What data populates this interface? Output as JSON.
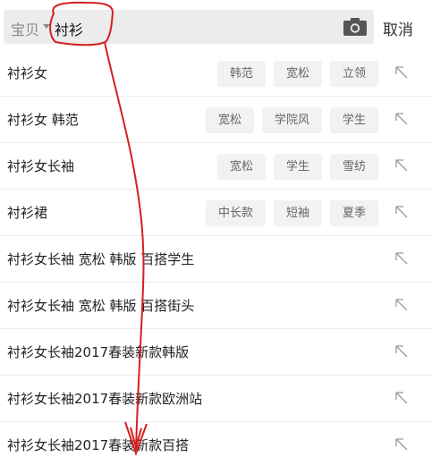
{
  "search": {
    "scope_label": "宝贝",
    "query": "衬衫"
  },
  "cancel_label": "取消",
  "icons": {
    "camera": "camera-icon",
    "fill": "arrow-up-left-icon",
    "caret": "caret-down-icon"
  },
  "colors": {
    "annotation": "#d42020",
    "search_bg": "#ececec",
    "chip_bg": "#f2f2f2"
  },
  "suggestions": [
    {
      "text": "衬衫女",
      "chips": [
        "韩范",
        "宽松",
        "立领"
      ]
    },
    {
      "text": "衬衫女 韩范",
      "chips": [
        "宽松",
        "学院风",
        "学生"
      ]
    },
    {
      "text": "衬衫女长袖",
      "chips": [
        "宽松",
        "学生",
        "雪纺"
      ]
    },
    {
      "text": "衬衫裙",
      "chips": [
        "中长款",
        "短袖",
        "夏季"
      ]
    },
    {
      "text": "衬衫女长袖 宽松 韩版 百搭学生",
      "chips": []
    },
    {
      "text": "衬衫女长袖 宽松 韩版 百搭街头",
      "chips": []
    },
    {
      "text": "衬衫女长袖2017春装新款韩版",
      "chips": []
    },
    {
      "text": "衬衫女长袖2017春装新款欧洲站",
      "chips": []
    },
    {
      "text": "衬衫女长袖2017春装新款百搭",
      "chips": []
    }
  ]
}
